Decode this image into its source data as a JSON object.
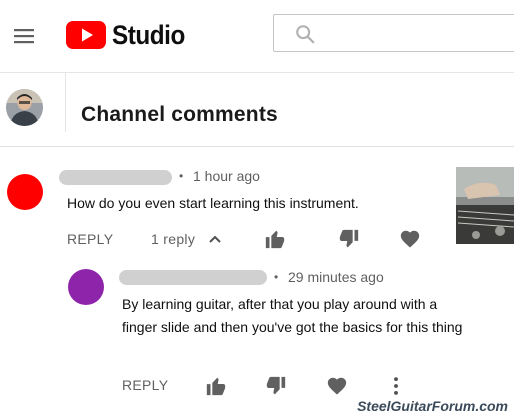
{
  "app": {
    "name": "Studio",
    "search_placeholder": ""
  },
  "page": {
    "title": "Channel comments"
  },
  "comment": {
    "separator": "•",
    "time": "1 hour ago",
    "text": "How do you even start learning this instrument.",
    "reply_label": "REPLY",
    "replies_label": "1 reply",
    "avatar_color": "#ff0000"
  },
  "reply": {
    "separator": "•",
    "time": "29 minutes ago",
    "text": "By learning guitar, after that you play around with a finger slide and then you've got the basics for this thing",
    "reply_label": "REPLY",
    "avatar_color": "#8e24aa"
  },
  "icons": {
    "menu": "menu-icon",
    "search": "search-icon",
    "like": "thumb-up-icon",
    "dislike": "thumb-down-icon",
    "heart": "heart-icon",
    "more": "more-vert-icon",
    "collapse": "chevron-up-icon"
  },
  "watermark": "SteelGuitarForum.com",
  "colors": {
    "brand_red": "#ff0000",
    "icon_gray": "#606060",
    "name_placeholder": "#d0d0d0"
  }
}
